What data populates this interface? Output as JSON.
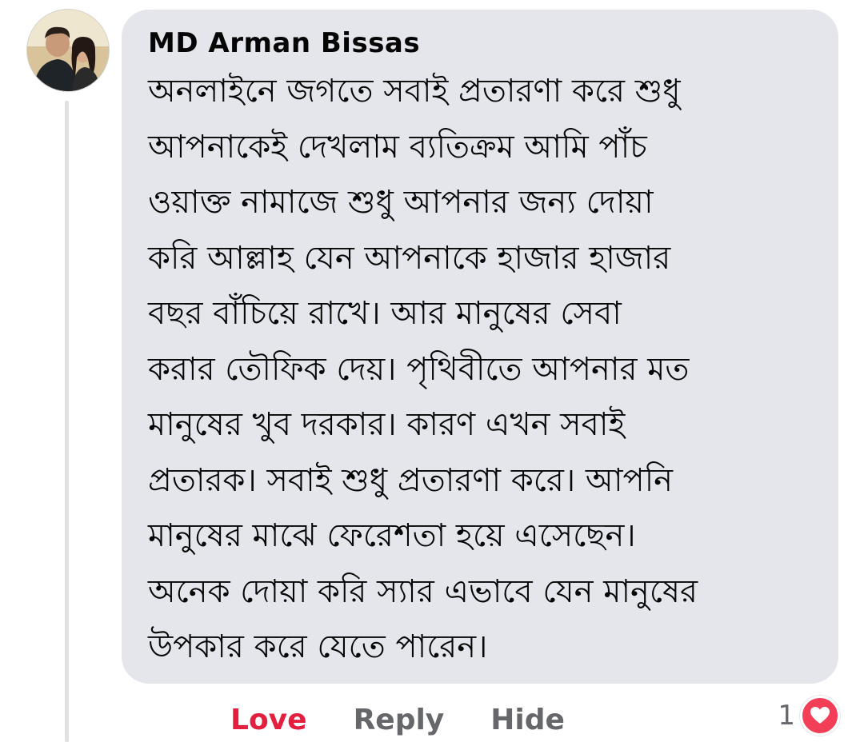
{
  "comment": {
    "author": "MD Arman Bissas",
    "lines": [
      "অনলাইনে জগতে সবাই প্রতারণা করে শুধু",
      "আপনাকেই দেখলাম ব্যতিক্রম আমি পাঁচ",
      "ওয়াক্ত নামাজে শুধু আপনার জন্য দোয়া",
      "করি আল্লাহ যেন আপনাকে হাজার হাজার",
      "বছর বাঁচিয়ে রাখে। আর মানুষের সেবা",
      "করার তৌফিক দেয়। পৃথিবীতে আপনার মত",
      "মানুষের খুব দরকার। কারণ এখন সবাই",
      "প্রতারক। সবাই শুধু প্রতারণা করে। আপনি",
      "মানুষের মাঝে ফেরেশতা হয়ে এসেছেন।",
      "অনেক দোয়া করি স্যার এভাবে যেন মানুষের",
      "উপকার করে যেতে পারেন।"
    ]
  },
  "actions": {
    "love_label": "Love",
    "reply_label": "Reply",
    "hide_label": "Hide"
  },
  "reactions": {
    "count": "1",
    "icon": "heart-icon"
  },
  "colors": {
    "bubble": "#e4e6eb",
    "love": "#e41e3f",
    "secondary_text": "#65676b",
    "heart_badge": "#f33e58"
  }
}
